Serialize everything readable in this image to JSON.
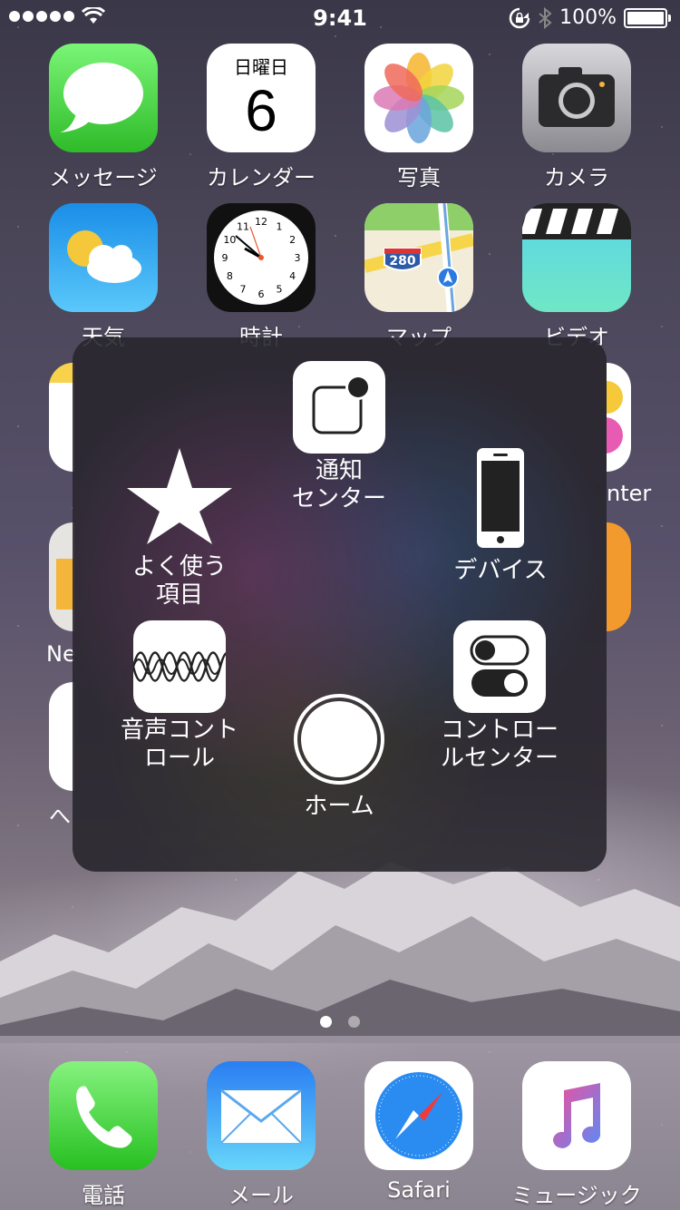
{
  "status_bar": {
    "time": "9:41",
    "battery": "100%"
  },
  "apps": [
    {
      "label": "メッセージ",
      "icon": "messages-icon"
    },
    {
      "label": "カレンダー",
      "icon": "calendar-icon",
      "weekday": "日曜日",
      "day": "6"
    },
    {
      "label": "写真",
      "icon": "photos-icon"
    },
    {
      "label": "カメラ",
      "icon": "camera-icon"
    },
    {
      "label": "天気",
      "icon": "weather-icon"
    },
    {
      "label": "時計",
      "icon": "clock-icon",
      "clock_numbers": [
        "12",
        "1",
        "2",
        "3",
        "4",
        "5",
        "6",
        "7",
        "8",
        "9",
        "10",
        "11"
      ]
    },
    {
      "label": "マップ",
      "icon": "maps-icon",
      "shield": "280"
    },
    {
      "label": "ビデオ",
      "icon": "videos-icon"
    }
  ],
  "partial_labels": {
    "right_row3": "nter",
    "left_row4": "Ne",
    "left_row5": "へ"
  },
  "assistive_menu": {
    "items": [
      {
        "label": "通知\nセンター",
        "icon": "notification-center-icon"
      },
      {
        "label": "よく使う\n項目",
        "icon": "star-icon"
      },
      {
        "label": "デバイス",
        "icon": "iphone-device-icon"
      },
      {
        "label": "音声コント\nロール",
        "icon": "waveform-icon"
      },
      {
        "label": "コントロー\nルセンター",
        "icon": "toggle-switches-icon"
      },
      {
        "label": "ホーム",
        "icon": "home-button-icon"
      }
    ]
  },
  "page_indicator": {
    "pages": 2,
    "current": 1
  },
  "dock": [
    {
      "label": "電話",
      "icon": "phone-icon"
    },
    {
      "label": "メール",
      "icon": "mail-icon"
    },
    {
      "label": "Safari",
      "icon": "safari-icon"
    },
    {
      "label": "ミュージック",
      "icon": "music-icon"
    }
  ]
}
